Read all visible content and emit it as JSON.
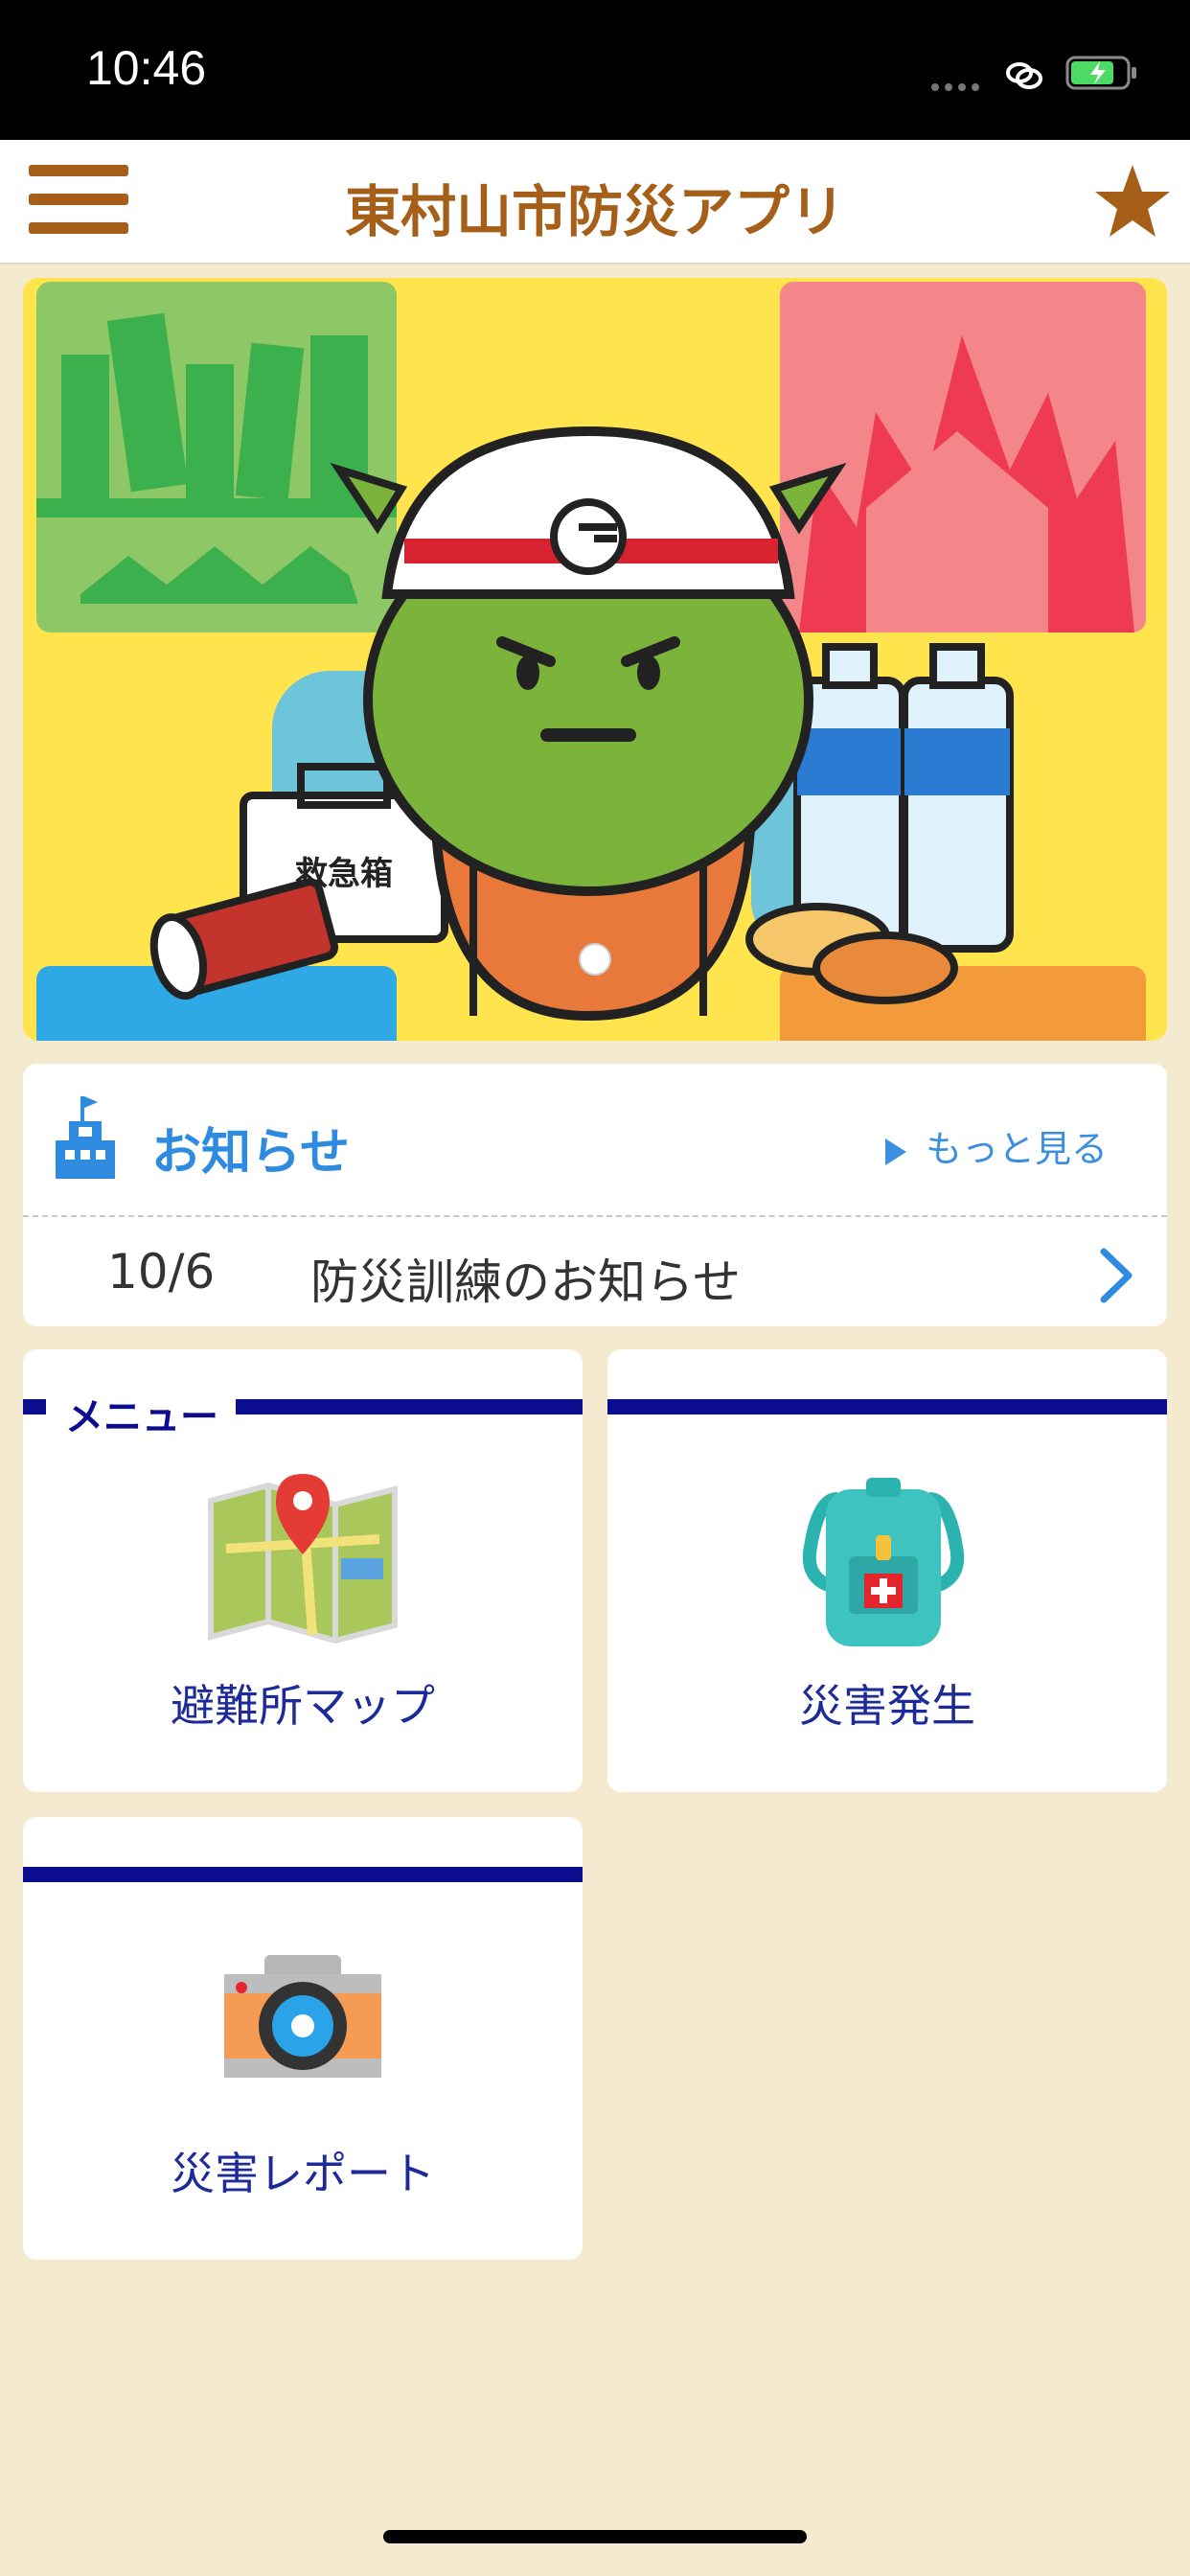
{
  "status_bar": {
    "time": "10:46",
    "battery": "charging"
  },
  "header": {
    "title": "東村山市防災アプリ",
    "menu_icon": "hamburger-icon",
    "favorite_icon": "star-icon"
  },
  "banner": {
    "sign_text": "救急箱",
    "slides": 1,
    "current_slide": 1
  },
  "notices": {
    "title": "お知らせ",
    "more_label": "もっと見る",
    "items": [
      {
        "date": "10/6",
        "text": "防災訓練のお知らせ"
      }
    ]
  },
  "menu": {
    "section_label": "メニュー",
    "items": [
      {
        "label": "避難所マップ",
        "icon": "map-icon"
      },
      {
        "label": "災害発生",
        "icon": "backpack-icon"
      },
      {
        "label": "災害レポート",
        "icon": "camera-icon"
      }
    ]
  },
  "colors": {
    "brand_brown": "#a65f19",
    "link_blue": "#2e8be0",
    "menu_navy": "#0b0c8e",
    "background": "#f3ead0"
  }
}
